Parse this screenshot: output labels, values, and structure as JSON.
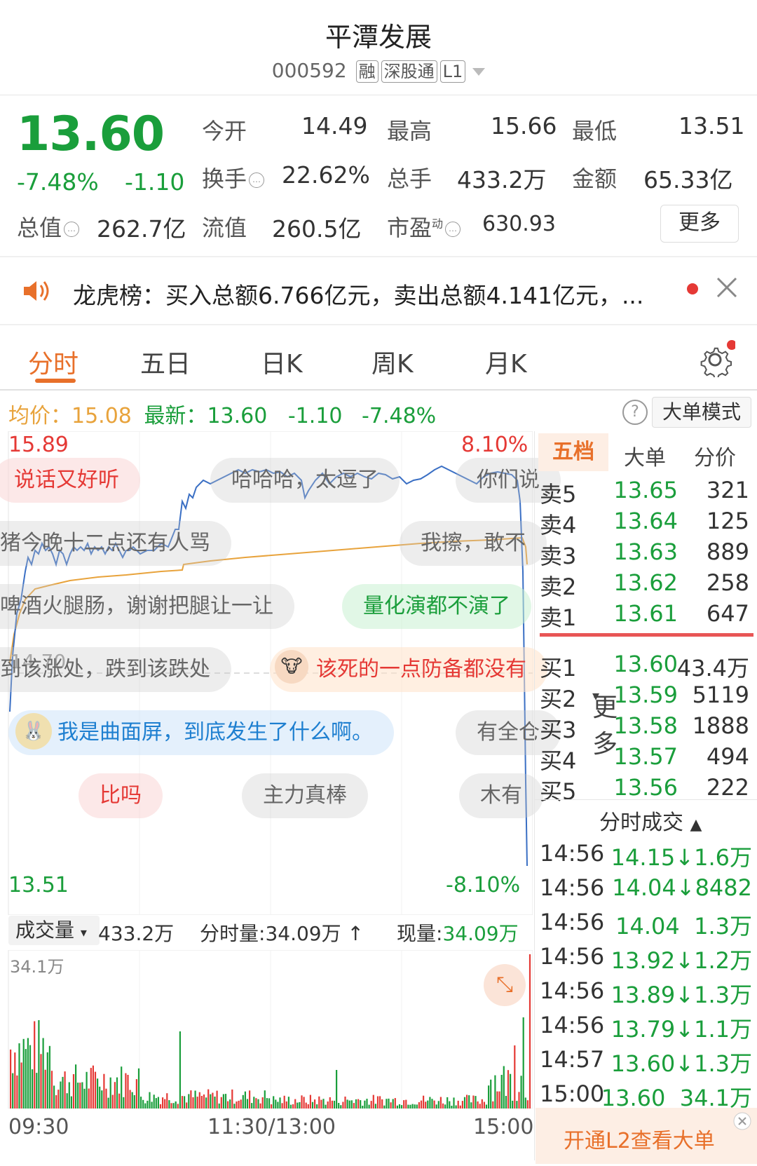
{
  "header": {
    "title": "平潭发展",
    "code": "000592",
    "tags": [
      "融",
      "深股通",
      "L1"
    ]
  },
  "quote": {
    "price": "13.60",
    "change_pct": "-7.48%",
    "change": "-1.10",
    "open_label": "今开",
    "open": "14.49",
    "high_label": "最高",
    "high": "15.66",
    "low_label": "最低",
    "low": "13.51",
    "turnover_label": "换手",
    "turnover": "22.62%",
    "volume_label": "总手",
    "volume": "433.2万",
    "amount_label": "金额",
    "amount": "65.33亿",
    "mktcap_label": "总值",
    "mktcap": "262.7亿",
    "float_label": "流值",
    "float": "260.5亿",
    "pe_label": "市盈",
    "pe_sup": "动",
    "pe": "630.93",
    "more_label": "更多"
  },
  "notice": {
    "text": "龙虎榜：买入总额6.766亿元，卖出总额4.141亿元，..."
  },
  "tabs": [
    "分时",
    "五日",
    "日K",
    "周K",
    "月K",
    "更多"
  ],
  "active_tab": 0,
  "chart_bar": {
    "avg_label": "均价：",
    "avg": "15.08",
    "last_label": "最新：",
    "last": "13.60",
    "chg": "-1.10",
    "pct": "-7.48%",
    "big_mode_label": "大单模式"
  },
  "chart_labels": {
    "y_high": "15.89",
    "y_low": "13.51",
    "pct_high": "8.10%",
    "pct_low": "-8.10%",
    "mid_price": "14.70"
  },
  "danmu": [
    "说话又好听",
    "哈哈哈，太逗了",
    "你们说",
    "猪今晚十二点还有人骂",
    "我擦，敢不",
    "啤酒火腿肠，谢谢把腿让一让",
    "量化演都不演了",
    "到该涨处，跌到该跌处",
    "该死的一点防备都没有",
    "我是曲面屏，到底发生了什么啊。",
    "有全仓",
    "比吗",
    "主力真棒",
    "木有"
  ],
  "volume_bar": {
    "label": "成交量",
    "total": "433.2万",
    "period_label": "分时量:",
    "period": "34.09万",
    "now_label": "现量:",
    "now": "34.09万",
    "y_max": "34.1万"
  },
  "x_axis": [
    "09:30",
    "11:30/13:00",
    "15:00"
  ],
  "order_book_tabs": [
    "五档",
    "大单",
    "分价"
  ],
  "asks": [
    {
      "name": "卖5",
      "price": "13.65",
      "qty": "321"
    },
    {
      "name": "卖4",
      "price": "13.64",
      "qty": "125"
    },
    {
      "name": "卖3",
      "price": "13.63",
      "qty": "889"
    },
    {
      "name": "卖2",
      "price": "13.62",
      "qty": "258"
    },
    {
      "name": "卖1",
      "price": "13.61",
      "qty": "647"
    }
  ],
  "bids": [
    {
      "name": "买1",
      "price": "13.60",
      "qty": "43.4万"
    },
    {
      "name": "买2",
      "price": "13.59",
      "qty": "5119"
    },
    {
      "name": "买3",
      "price": "13.58",
      "qty": "1888"
    },
    {
      "name": "买4",
      "price": "13.57",
      "qty": "494"
    },
    {
      "name": "买5",
      "price": "13.56",
      "qty": "222"
    }
  ],
  "trades_title": "分时成交",
  "trades": [
    {
      "time": "14:56",
      "pv": "14.15↓1.6万"
    },
    {
      "time": "14:56",
      "pv": "14.04↓8482"
    },
    {
      "time": "14:56",
      "pv": "14.04  1.3万"
    },
    {
      "time": "14:56",
      "pv": "13.92↓1.2万"
    },
    {
      "time": "14:56",
      "pv": "13.89↓1.3万"
    },
    {
      "time": "14:56",
      "pv": "13.79↓1.1万"
    },
    {
      "time": "14:57",
      "pv": "13.60↓1.3万"
    },
    {
      "time": "15:00",
      "pv": "13.60  34.1万"
    }
  ],
  "l2_label": "开通L2查看大单",
  "colors": {
    "up": "#e53935",
    "down": "#1a9e3b",
    "price_line": "#3a6fc4",
    "avg_line": "#e8a33c",
    "accent": "#e8702a"
  }
}
